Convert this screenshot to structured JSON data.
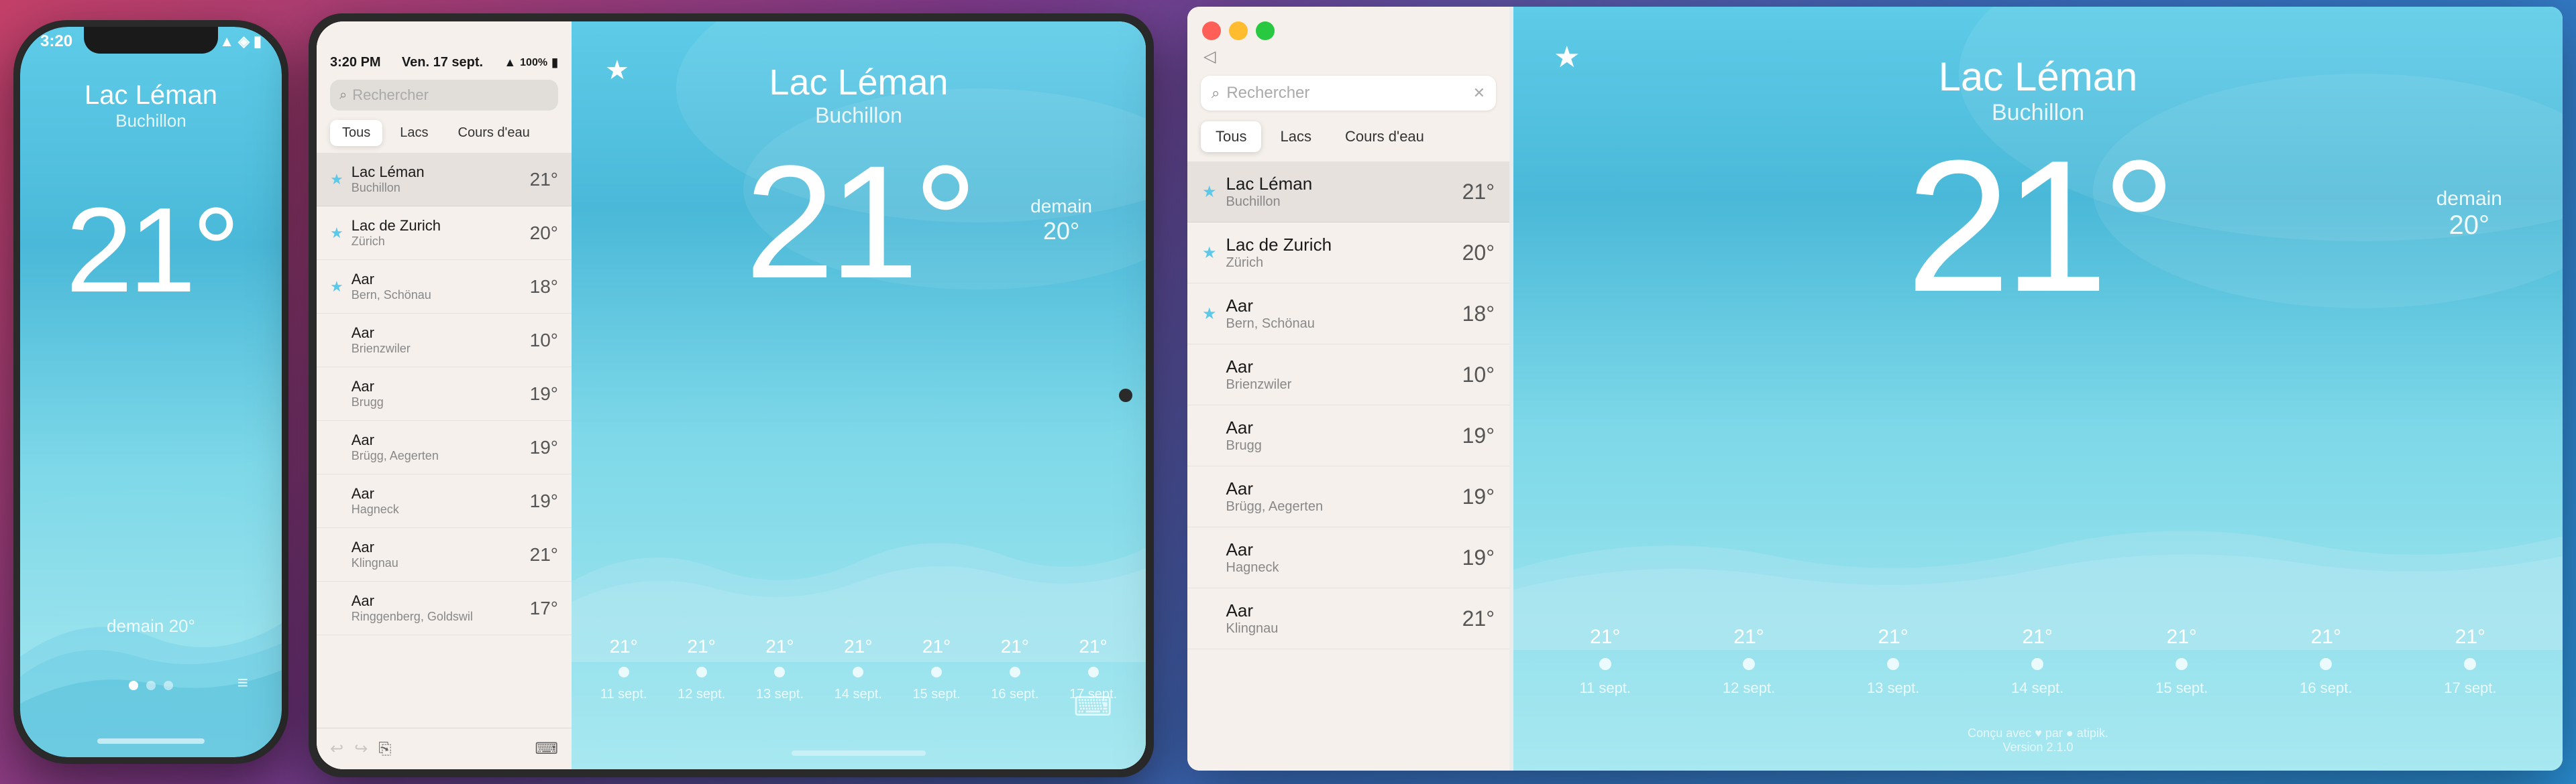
{
  "phone": {
    "time": "3:20",
    "city": "Lac Léman",
    "suburb": "Buchillon",
    "temperature": "21°",
    "tomorrow": "demain 20°",
    "status_icons": "▲ ⬤"
  },
  "tablet": {
    "status_time": "3:20 PM",
    "status_date": "Ven. 17 sept.",
    "status_battery": "📶 100% 🔋",
    "search_placeholder": "Rechercher",
    "tabs": [
      {
        "label": "Tous",
        "active": true
      },
      {
        "label": "Lacs",
        "active": false
      },
      {
        "label": "Cours d'eau",
        "active": false
      }
    ],
    "city": "Lac Léman",
    "suburb": "Buchillon",
    "temperature": "21°",
    "tomorrow": "demain",
    "tomorrow_temp": "20°",
    "locations": [
      {
        "name": "Lac Léman",
        "sub": "Buchillon",
        "temp": "21°",
        "starred": true,
        "active": true
      },
      {
        "name": "Lac de Zurich",
        "sub": "Zürich",
        "temp": "20°",
        "starred": true,
        "active": false
      },
      {
        "name": "Aar",
        "sub": "Bern, Schönau",
        "temp": "18°",
        "starred": true,
        "active": false
      },
      {
        "name": "Aar",
        "sub": "Brienzwiler",
        "temp": "10°",
        "starred": false,
        "active": false
      },
      {
        "name": "Aar",
        "sub": "Brugg",
        "temp": "19°",
        "starred": false,
        "active": false
      },
      {
        "name": "Aar",
        "sub": "Brügg, Aegerten",
        "temp": "19°",
        "starred": false,
        "active": false
      },
      {
        "name": "Aar",
        "sub": "Hagneck",
        "temp": "19°",
        "starred": false,
        "active": false
      },
      {
        "name": "Aar",
        "sub": "Klingnau",
        "temp": "21°",
        "starred": false,
        "active": false
      },
      {
        "name": "Aar",
        "sub": "Ringgenberg, Goldswil",
        "temp": "17°",
        "starred": false,
        "active": false
      }
    ],
    "forecast": [
      {
        "temp": "21°",
        "date": "11 sept."
      },
      {
        "temp": "21°",
        "date": "12 sept."
      },
      {
        "temp": "21°",
        "date": "13 sept."
      },
      {
        "temp": "21°",
        "date": "14 sept."
      },
      {
        "temp": "21°",
        "date": "15 sept."
      },
      {
        "temp": "21°",
        "date": "16 sept."
      },
      {
        "temp": "21°",
        "date": "17 sept."
      }
    ]
  },
  "mac": {
    "search_placeholder": "Rechercher",
    "tabs": [
      {
        "label": "Tous",
        "active": true
      },
      {
        "label": "Lacs",
        "active": false
      },
      {
        "label": "Cours d'eau",
        "active": false
      }
    ],
    "city": "Lac Léman",
    "suburb": "Buchillon",
    "temperature": "21°",
    "tomorrow": "demain",
    "tomorrow_temp": "20°",
    "locations": [
      {
        "name": "Lac Léman",
        "sub": "Buchillon",
        "temp": "21°",
        "starred": true,
        "active": true
      },
      {
        "name": "Lac de Zurich",
        "sub": "Zürich",
        "temp": "20°",
        "starred": true,
        "active": false
      },
      {
        "name": "Aar",
        "sub": "Bern, Schönau",
        "temp": "18°",
        "starred": true,
        "active": false
      },
      {
        "name": "Aar",
        "sub": "Brienzwiler",
        "temp": "10°",
        "starred": false,
        "active": false
      },
      {
        "name": "Aar",
        "sub": "Brugg",
        "temp": "19°",
        "starred": false,
        "active": false
      },
      {
        "name": "Aar",
        "sub": "Brügg, Aegerten",
        "temp": "19°",
        "starred": false,
        "active": false
      },
      {
        "name": "Aar",
        "sub": "Hagneck",
        "temp": "19°",
        "starred": false,
        "active": false
      },
      {
        "name": "Aar",
        "sub": "Klingnau",
        "temp": "21°",
        "starred": false,
        "active": false
      }
    ],
    "forecast": [
      {
        "temp": "21°",
        "date": "11 sept."
      },
      {
        "temp": "21°",
        "date": "12 sept."
      },
      {
        "temp": "21°",
        "date": "13 sept."
      },
      {
        "temp": "21°",
        "date": "14 sept."
      },
      {
        "temp": "21°",
        "date": "15 sept."
      },
      {
        "temp": "21°",
        "date": "16 sept."
      },
      {
        "temp": "21°",
        "date": "17 sept."
      }
    ],
    "footer": "Conçu avec ♥ par ● atipik.",
    "version": "Version 2.1.0"
  }
}
